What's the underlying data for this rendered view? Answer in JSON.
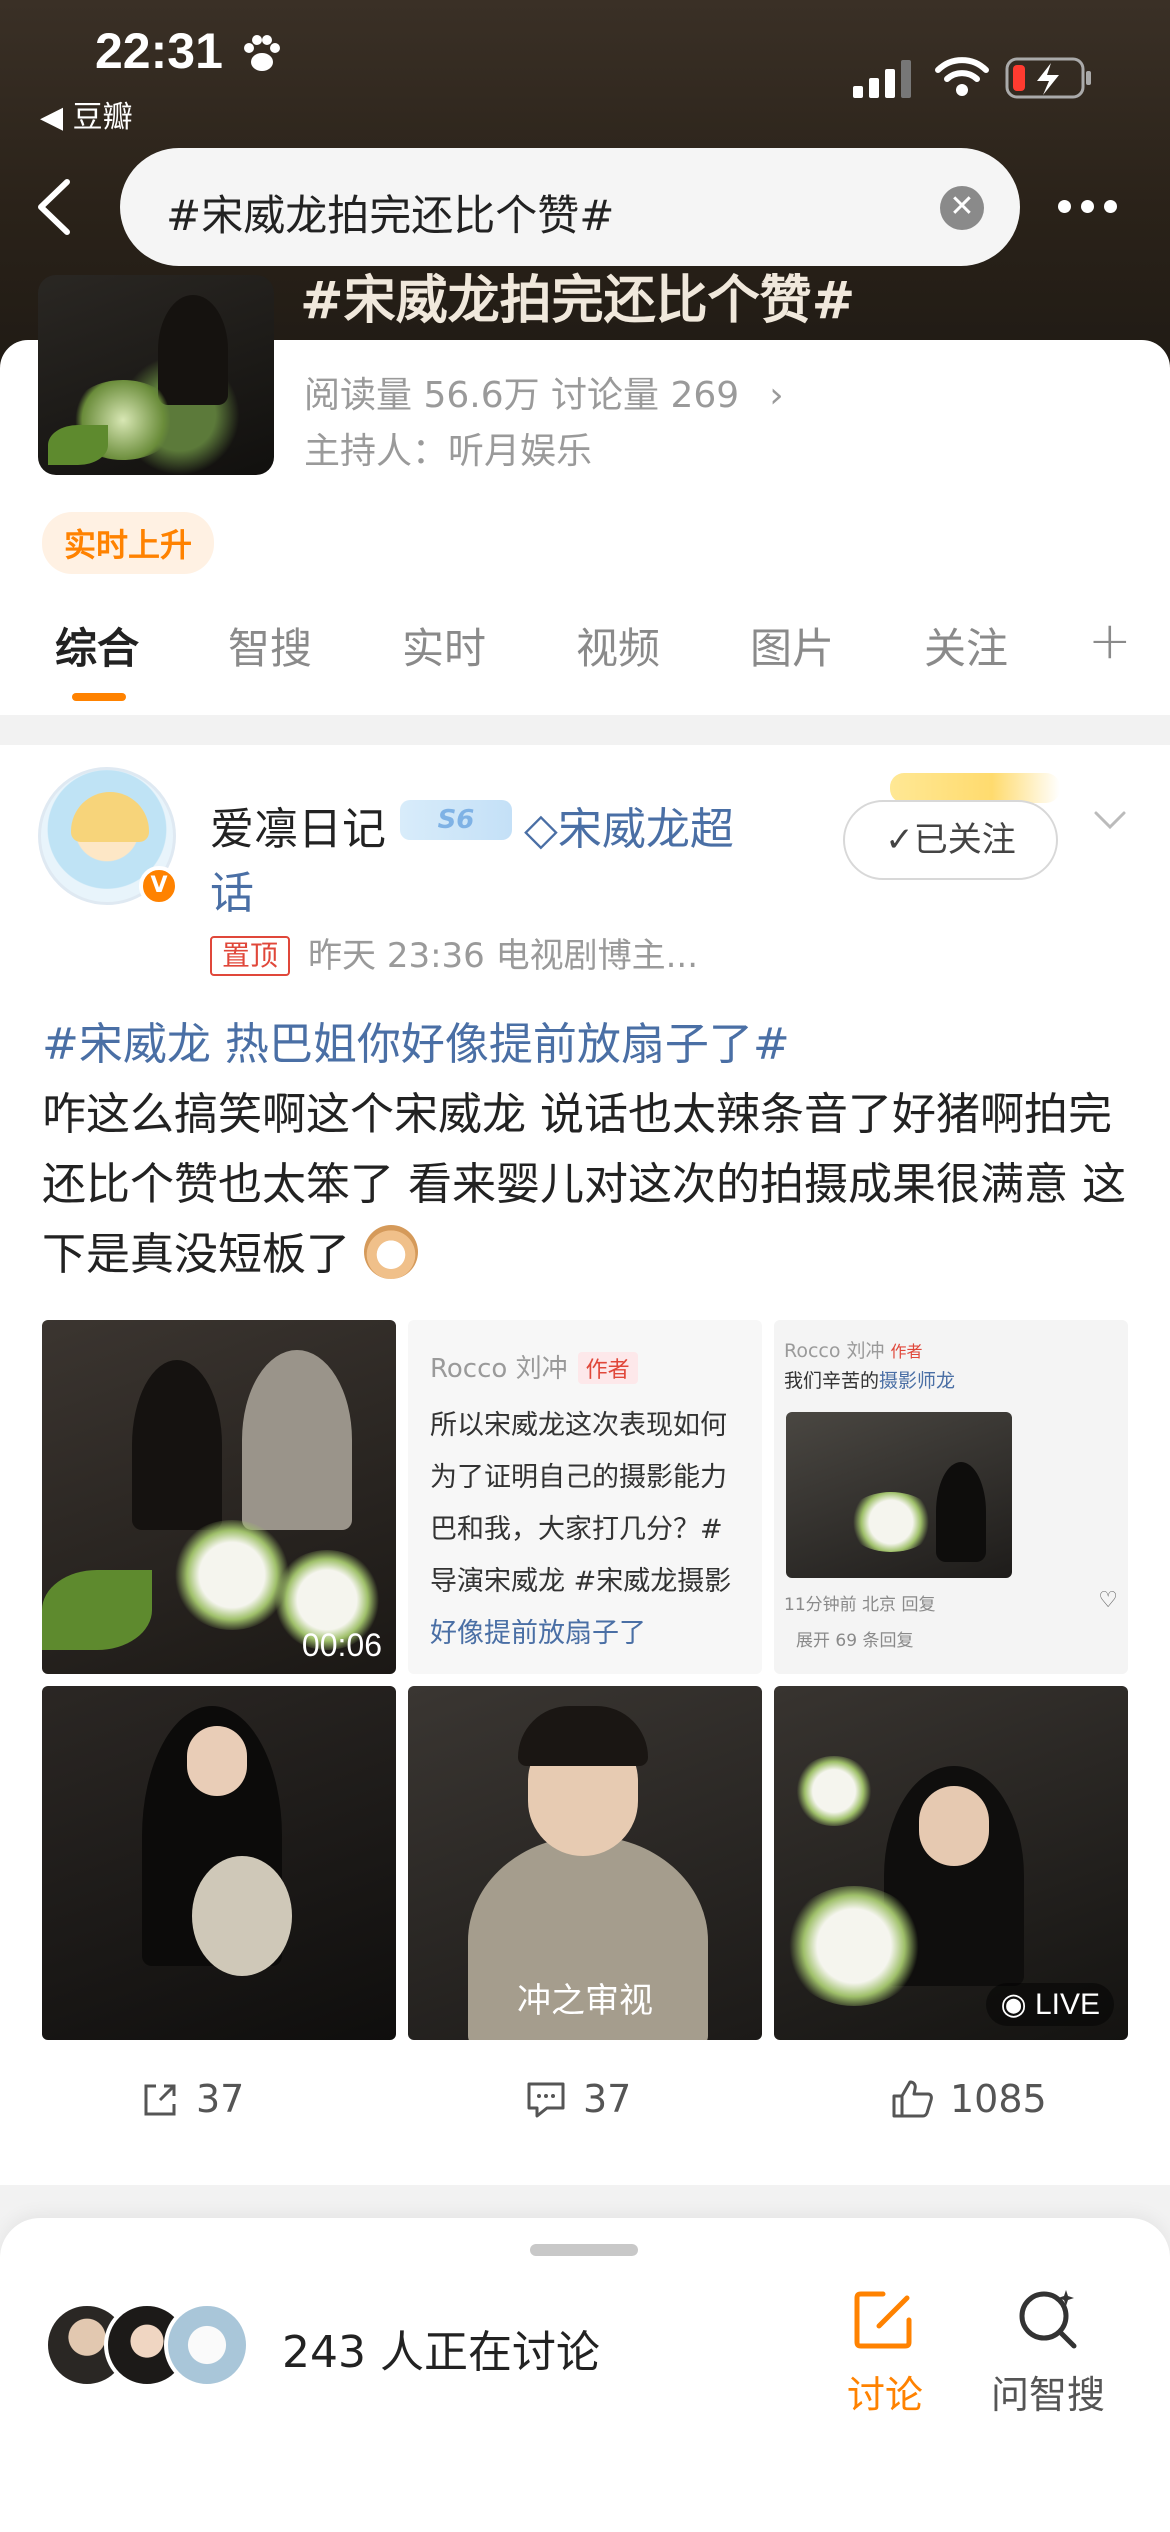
{
  "status_bar": {
    "time": "22:31",
    "back_app": "◀ 豆瓣"
  },
  "search": {
    "query": "#宋威龙拍完还比个赞#",
    "clear_glyph": "✕"
  },
  "topic": {
    "title_behind": "#宋威龙拍完还比个赞#",
    "stats": "阅读量 56.6万  讨论量 269",
    "host": "主持人：听月娱乐",
    "hot_badge": "实时上升"
  },
  "tabs": [
    "综合",
    "智搜",
    "实时",
    "视频",
    "图片",
    "关注"
  ],
  "post": {
    "username": "爱凛日记",
    "level": "S6",
    "super_topic_line1": "◇宋威龙超",
    "super_topic_line2": "话",
    "pin": "置顶",
    "meta": "昨天 23:36  电视剧博主...",
    "follow": "✓已关注",
    "tag": "#宋威龙 热巴姐你好像提前放扇子了#",
    "text": "咋这么搞笑啊这个宋威龙 说话也太辣条音了好猪啊拍完还比个赞也太笨了 看来婴儿对这次的拍摄成果很满意 这下是真没短板了",
    "video_duration": "00:06",
    "comment_card": {
      "author": "Rocco 刘冲",
      "author_tag": "作者",
      "lines": [
        "所以宋威龙这次表现如何",
        "为了证明自己的摄影能力",
        "巴和我，大家打几分？#",
        "导演宋威龙 #宋威龙摄影",
        "好像提前放扇子了"
      ]
    },
    "mini_card": {
      "author": "Rocco 刘冲",
      "author_tag": "作者",
      "text_prefix": "我们辛苦的",
      "text_link": "摄影师龙",
      "meta": "11分钟前 北京  回复",
      "expand": "展开 69 条回复"
    },
    "caption_5": "冲之审视",
    "live_label": "LIVE",
    "actions": {
      "repost": "37",
      "comment": "37",
      "like": "1085"
    }
  },
  "bottom_sheet": {
    "discussing": "243 人正在讨论",
    "discuss_btn": "讨论",
    "ask_btn": "问智搜"
  },
  "colors": {
    "accent": "#ff8200",
    "link": "#4a6fa5",
    "pin": "#e0473a"
  }
}
